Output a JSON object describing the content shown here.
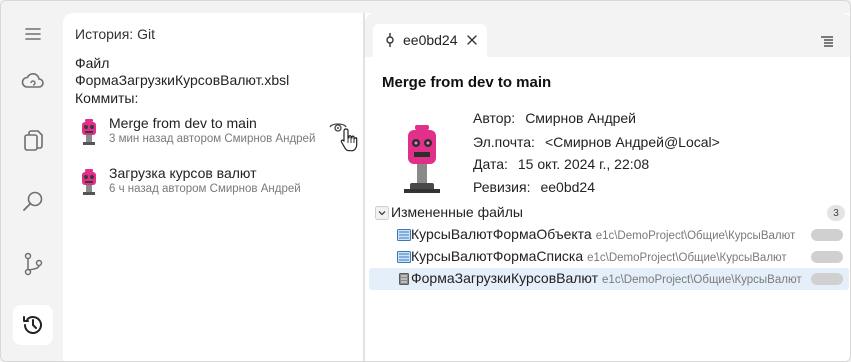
{
  "history_panel": {
    "title": "История: Git",
    "file_label": "Файл",
    "file_name": "ФормаЗагрузкиКурсовВалют.xbsl",
    "commits_label": "Коммиты:",
    "commits": [
      {
        "message": "Merge from dev to main",
        "meta": "3 мин назад автором Смирнов Андрей"
      },
      {
        "message": "Загрузка курсов валют",
        "meta": "6 ч назад автором Смирнов Андрей"
      }
    ]
  },
  "tab": {
    "label": "ee0bd24"
  },
  "commit_details": {
    "title": "Merge from dev to main",
    "author_label": "Автор:",
    "author": "Смирнов Андрей",
    "email_label": "Эл.почта:",
    "email": "<Смирнов Андрей@Local>",
    "date_label": "Дата:",
    "date": "15 окт. 2024 г., 22:08",
    "revision_label": "Ревизия:",
    "revision": "ee0bd24"
  },
  "changed_files": {
    "label": "Измененные файлы",
    "count": "3",
    "files": [
      {
        "name": "КурсыВалютФормаОбъекта",
        "path": "e1c\\DemoProject\\Общие\\КурсыВалют"
      },
      {
        "name": "КурсыВалютФормаСписка",
        "path": "e1c\\DemoProject\\Общие\\КурсыВалют"
      },
      {
        "name": "ФормаЗагрузкиКурсовВалют",
        "path": "e1c\\DemoProject\\Общие\\КурсыВалют"
      }
    ]
  },
  "icons": {
    "activity": [
      "menu-icon",
      "cloud-icon",
      "files-icon",
      "search-icon",
      "source-control-icon",
      "history-icon"
    ],
    "accent": "#ffd400",
    "selection": "#e5effa"
  }
}
